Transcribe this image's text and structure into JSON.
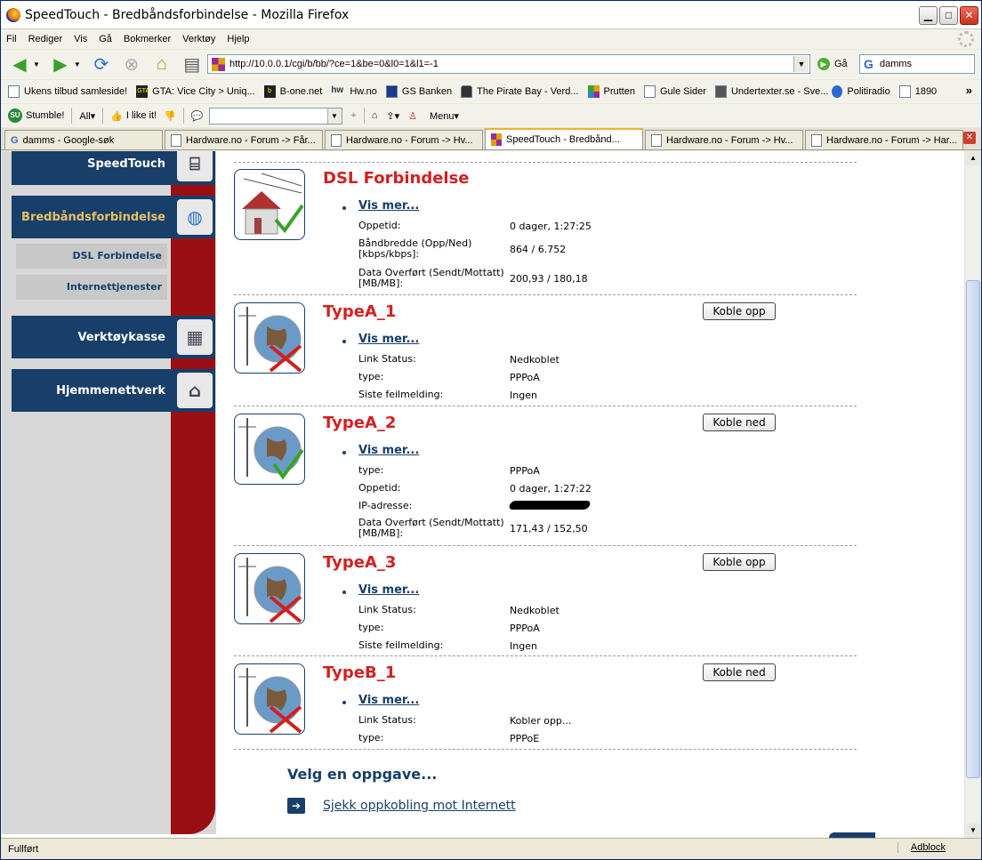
{
  "window": {
    "title": "SpeedTouch - Bredbåndsforbindelse - Mozilla Firefox"
  },
  "menu": [
    "Fil",
    "Rediger",
    "Vis",
    "Gå",
    "Bokmerker",
    "Verktøy",
    "Hjelp"
  ],
  "nav": {
    "url": "http://10.0.0.1/cgi/b/bb/?ce=1&be=0&l0=1&l1=-1",
    "go_label": "Gå",
    "search_value": "damms"
  },
  "bookmarks": [
    "Ukens tilbud samleside!",
    "GTA: Vice City > Uniq...",
    "B-one.net",
    "Hw.no",
    "GS Banken",
    "The Pirate Bay - Verd...",
    "Prutten",
    "Gule Sider",
    "Undertexter.se - Sve...",
    "Politiradio",
    "1890"
  ],
  "bookmarks_more": "»",
  "stumble": {
    "stumble": "Stumble!",
    "all": "All▾",
    "like": "I like it!",
    "menu": "Menu▾"
  },
  "tabs": [
    "damms - Google-søk",
    "Hardware.no - Forum -> Får...",
    "Hardware.no - Forum -> Hv...",
    "SpeedTouch - Bredbånd...",
    "Hardware.no - Forum -> Hv...",
    "Hardware.no - Forum -> Har..."
  ],
  "sidebar": {
    "items": [
      "SpeedTouch",
      "Bredbåndsforbindelse",
      "Verktøykasse",
      "Hjemmenettverk"
    ],
    "subitems": [
      "DSL Forbindelse",
      "Internettjenester"
    ]
  },
  "sections": [
    {
      "title": "DSL Forbindelse",
      "vis_mer": "Vis mer...",
      "rows": [
        {
          "label": "Oppetid:",
          "value": "0 dager, 1:27:25"
        },
        {
          "label": "Båndbredde (Opp/Ned) [kbps/kbps]:",
          "value": "864 / 6.752"
        },
        {
          "label": "Data Overført (Sendt/Mottatt) [MB/MB]:",
          "value": "200,93 / 180,18"
        }
      ]
    },
    {
      "title": "TypeA_1",
      "button": "Koble opp",
      "vis_mer": "Vis mer...",
      "rows": [
        {
          "label": "Link Status:",
          "value": "Nedkoblet"
        },
        {
          "label": "type:",
          "value": "PPPoA"
        },
        {
          "label": "Siste feilmelding:",
          "value": "Ingen"
        }
      ]
    },
    {
      "title": "TypeA_2",
      "button": "Koble ned",
      "vis_mer": "Vis mer...",
      "rows": [
        {
          "label": "type:",
          "value": "PPPoA"
        },
        {
          "label": "Oppetid:",
          "value": "0 dager, 1:27:22"
        },
        {
          "label": "IP-adresse:",
          "value": ""
        },
        {
          "label": "Data Overført (Sendt/Mottatt) [MB/MB]:",
          "value": "171,43 / 152,50"
        }
      ]
    },
    {
      "title": "TypeA_3",
      "button": "Koble opp",
      "vis_mer": "Vis mer...",
      "rows": [
        {
          "label": "Link Status:",
          "value": "Nedkoblet"
        },
        {
          "label": "type:",
          "value": "PPPoA"
        },
        {
          "label": "Siste feilmelding:",
          "value": "Ingen"
        }
      ]
    },
    {
      "title": "TypeB_1",
      "button": "Koble ned",
      "vis_mer": "Vis mer...",
      "rows": [
        {
          "label": "Link Status:",
          "value": "Kobler opp..."
        },
        {
          "label": "type:",
          "value": "PPPoE"
        }
      ]
    }
  ],
  "task": {
    "heading": "Velg en oppgave...",
    "link": "Sjekk oppkobling mot Internett"
  },
  "status": {
    "text": "Fullført",
    "adblock": "Adblock"
  },
  "colors": {
    "navy": "#183e6a",
    "red": "#9a0f14",
    "title_red": "#d32020"
  }
}
